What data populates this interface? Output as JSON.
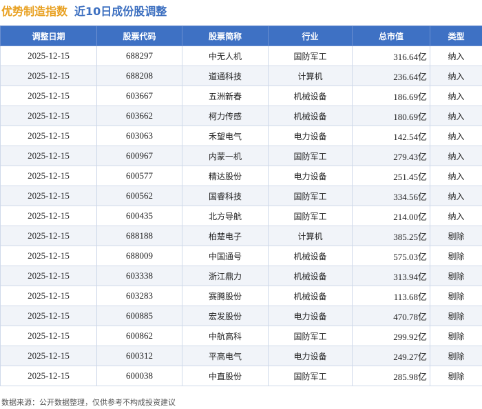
{
  "header": {
    "index_name": "优势制造指数",
    "subtitle": "近10日成份股调整"
  },
  "table": {
    "columns": [
      "调整日期",
      "股票代码",
      "股票简称",
      "行业",
      "总市值",
      "类型"
    ],
    "rows": [
      {
        "date": "2025-12-15",
        "code": "688297",
        "name": "中无人机",
        "industry": "国防军工",
        "cap": "316.64亿",
        "type": "纳入"
      },
      {
        "date": "2025-12-15",
        "code": "688208",
        "name": "道通科技",
        "industry": "计算机",
        "cap": "236.64亿",
        "type": "纳入"
      },
      {
        "date": "2025-12-15",
        "code": "603667",
        "name": "五洲新春",
        "industry": "机械设备",
        "cap": "186.69亿",
        "type": "纳入"
      },
      {
        "date": "2025-12-15",
        "code": "603662",
        "name": "柯力传感",
        "industry": "机械设备",
        "cap": "180.69亿",
        "type": "纳入"
      },
      {
        "date": "2025-12-15",
        "code": "603063",
        "name": "禾望电气",
        "industry": "电力设备",
        "cap": "142.54亿",
        "type": "纳入"
      },
      {
        "date": "2025-12-15",
        "code": "600967",
        "name": "内蒙一机",
        "industry": "国防军工",
        "cap": "279.43亿",
        "type": "纳入"
      },
      {
        "date": "2025-12-15",
        "code": "600577",
        "name": "精达股份",
        "industry": "电力设备",
        "cap": "251.45亿",
        "type": "纳入"
      },
      {
        "date": "2025-12-15",
        "code": "600562",
        "name": "国睿科技",
        "industry": "国防军工",
        "cap": "334.56亿",
        "type": "纳入"
      },
      {
        "date": "2025-12-15",
        "code": "600435",
        "name": "北方导航",
        "industry": "国防军工",
        "cap": "214.00亿",
        "type": "纳入"
      },
      {
        "date": "2025-12-15",
        "code": "688188",
        "name": "柏楚电子",
        "industry": "计算机",
        "cap": "385.25亿",
        "type": "剔除"
      },
      {
        "date": "2025-12-15",
        "code": "688009",
        "name": "中国通号",
        "industry": "机械设备",
        "cap": "575.03亿",
        "type": "剔除"
      },
      {
        "date": "2025-12-15",
        "code": "603338",
        "name": "浙江鼎力",
        "industry": "机械设备",
        "cap": "313.94亿",
        "type": "剔除"
      },
      {
        "date": "2025-12-15",
        "code": "603283",
        "name": "赛腾股份",
        "industry": "机械设备",
        "cap": "113.68亿",
        "type": "剔除"
      },
      {
        "date": "2025-12-15",
        "code": "600885",
        "name": "宏发股份",
        "industry": "电力设备",
        "cap": "470.78亿",
        "type": "剔除"
      },
      {
        "date": "2025-12-15",
        "code": "600862",
        "name": "中航高科",
        "industry": "国防军工",
        "cap": "299.92亿",
        "type": "剔除"
      },
      {
        "date": "2025-12-15",
        "code": "600312",
        "name": "平高电气",
        "industry": "电力设备",
        "cap": "249.27亿",
        "type": "剔除"
      },
      {
        "date": "2025-12-15",
        "code": "600038",
        "name": "中直股份",
        "industry": "国防军工",
        "cap": "285.98亿",
        "type": "剔除"
      }
    ]
  },
  "footer": {
    "source_note": "数据来源：公开数据整理，仅供参考不构成投资建议"
  },
  "colors": {
    "header_bg": "#3e71c4",
    "index_name": "#e8a020",
    "subtitle": "#3c6fc0",
    "row_alt": "#f1f4f9"
  }
}
